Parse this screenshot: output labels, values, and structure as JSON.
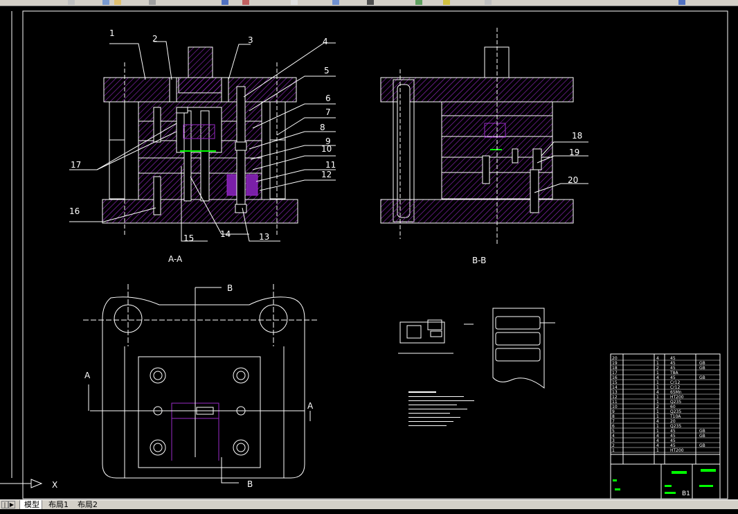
{
  "tabs": {
    "model": "模型",
    "layout1": "布局1",
    "layout2": "布局2"
  },
  "drawing": {
    "section_aa_label": "A-A",
    "section_bb_label": "B-B",
    "cut_label_a_left": "A",
    "cut_label_a_right": "A",
    "cut_label_b_top": "B",
    "cut_label_b_bottom": "B",
    "ucs_x_label": "X",
    "part_numbers_aa": [
      "1",
      "2",
      "3",
      "4",
      "5",
      "6",
      "7",
      "8",
      "9",
      "10",
      "11",
      "12",
      "13",
      "14",
      "15",
      "16",
      "17"
    ],
    "part_numbers_bb": [
      "18",
      "19",
      "20"
    ]
  },
  "bom": {
    "rows": [
      [
        "20",
        "",
        "4",
        "45",
        ""
      ],
      [
        "19",
        "",
        "1",
        "45",
        "GB"
      ],
      [
        "18",
        "",
        "2",
        "45",
        "GB"
      ],
      [
        "17",
        "",
        "1",
        "T8A",
        ""
      ],
      [
        "16",
        "",
        "4",
        "45",
        "GB"
      ],
      [
        "15",
        "",
        "1",
        "Cr12",
        ""
      ],
      [
        "14",
        "",
        "1",
        "Cr12",
        ""
      ],
      [
        "13",
        "",
        "4",
        "65Mn",
        ""
      ],
      [
        "12",
        "",
        "1",
        "HT200",
        ""
      ],
      [
        "11",
        "",
        "1",
        "Q235",
        ""
      ],
      [
        "10",
        "",
        "2",
        "60",
        ""
      ],
      [
        "9",
        "",
        "1",
        "Q235",
        ""
      ],
      [
        "8",
        "",
        "1",
        "T10A",
        ""
      ],
      [
        "7",
        "",
        "4",
        "20",
        ""
      ],
      [
        "6",
        "",
        "1",
        "Q235",
        ""
      ],
      [
        "5",
        "",
        "1",
        "45",
        "GB"
      ],
      [
        "4",
        "",
        "4",
        "45",
        "GB"
      ],
      [
        "3",
        "",
        "4",
        "45",
        ""
      ],
      [
        "2",
        "",
        "4",
        "45",
        "GB"
      ],
      [
        "1",
        "",
        "1",
        "HT200",
        ""
      ]
    ],
    "footer_label": "B1"
  },
  "colors": {
    "background": "#000000",
    "lines": "#ffffff",
    "hatch": "#9a2bc9",
    "accent_green": "#00ff00",
    "ui_gray": "#d4d0c8"
  }
}
